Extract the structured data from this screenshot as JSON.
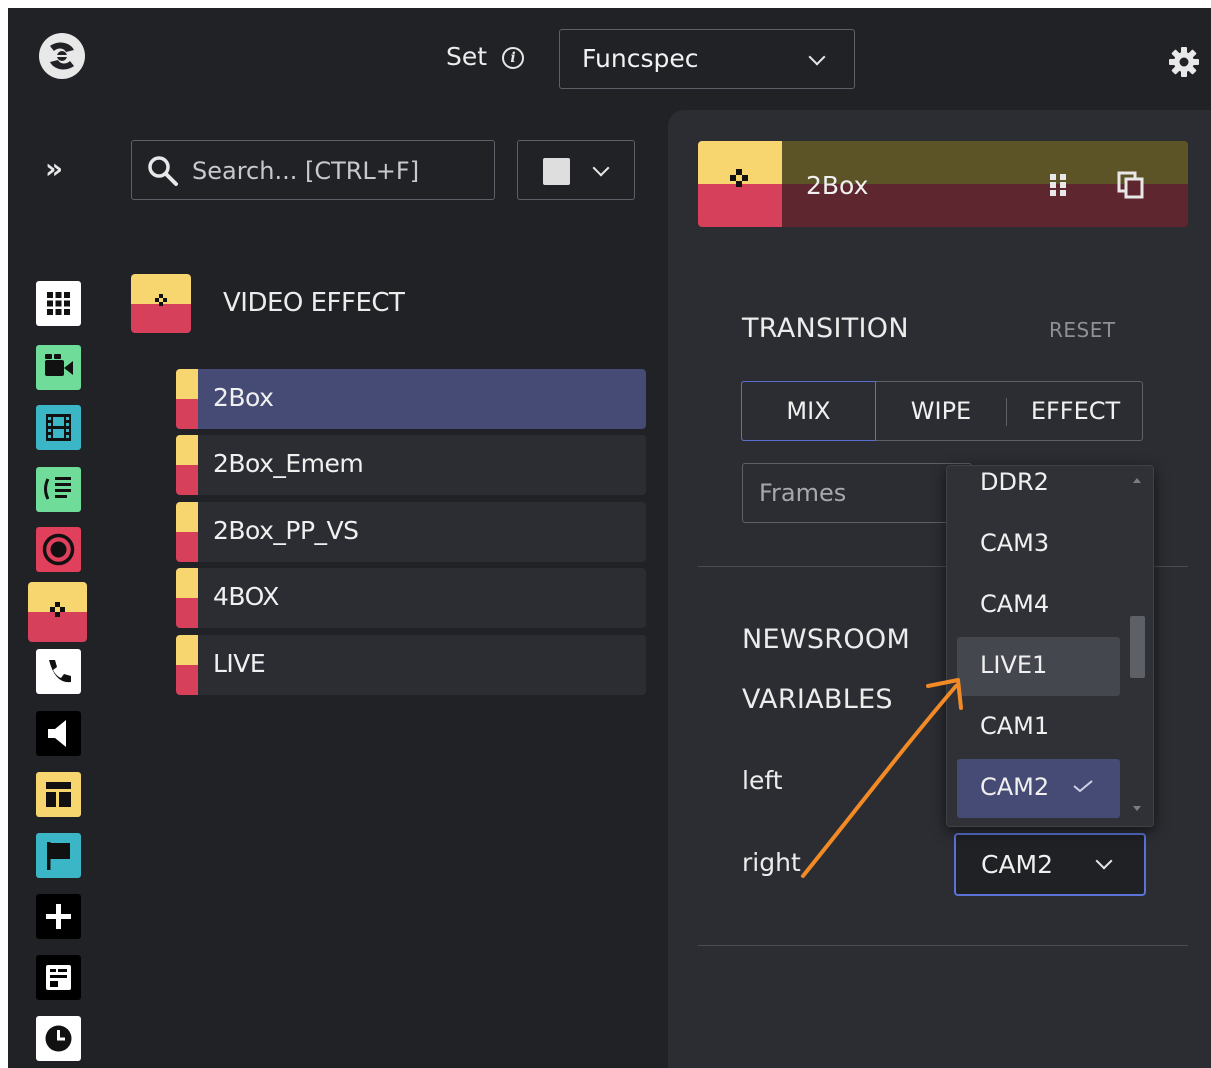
{
  "topbar": {
    "set_label": "Set",
    "set_info_icon": "info-icon",
    "set_value": "Funcspec",
    "settings_icon": "gear-icon"
  },
  "sidebar": {
    "expand_label": "»",
    "search_placeholder": "Search... [CTRL+F]",
    "items": [
      {
        "name": "grid-icon",
        "bg": "#ffffff"
      },
      {
        "name": "camera-icon",
        "bg": "#6fdc9a"
      },
      {
        "name": "film-icon",
        "bg": "#3bb6c6"
      },
      {
        "name": "voiceover-icon",
        "bg": "#6fdc9a"
      },
      {
        "name": "record-icon",
        "bg": "#e0405c"
      },
      {
        "name": "video-effect-icon",
        "bg": "#f7d56f",
        "active": true
      },
      {
        "name": "phone-icon",
        "bg": "#ffffff"
      },
      {
        "name": "speaker-icon",
        "bg": "#000000"
      },
      {
        "name": "layout-icon",
        "bg": "#f7d56f"
      },
      {
        "name": "flag-icon",
        "bg": "#3bb6c6"
      },
      {
        "name": "plus-icon",
        "bg": "#000000"
      },
      {
        "name": "playlist-icon",
        "bg": "#000000"
      },
      {
        "name": "clock-icon",
        "bg": "#ffffff"
      }
    ]
  },
  "category": {
    "label": "VIDEO EFFECT"
  },
  "effects": [
    {
      "label": "2Box",
      "selected": true
    },
    {
      "label": "2Box_Emem"
    },
    {
      "label": "2Box_PP_VS"
    },
    {
      "label": "4BOX"
    },
    {
      "label": "LIVE"
    }
  ],
  "detail": {
    "title": "2Box",
    "transition_title": "TRANSITION",
    "reset_label": "RESET",
    "transition_options": [
      "MIX",
      "WIPE",
      "EFFECT"
    ],
    "transition_active": "MIX",
    "frames_placeholder": "Frames",
    "newsroom_title_line1": "NEWSROOM",
    "newsroom_title_line2": "VARIABLES",
    "left_label": "left",
    "right_label": "right",
    "right_value": "CAM2"
  },
  "dropdown": {
    "options": [
      "DDR2",
      "CAM3",
      "CAM4",
      "LIVE1",
      "CAM1",
      "CAM2"
    ],
    "hovered": "LIVE1",
    "selected": "CAM2"
  },
  "colors": {
    "accent": "#5b73d6",
    "selected_bg": "#454b74",
    "yellow": "#f7d56f",
    "red": "#d6405a",
    "annotation": "#f28a26"
  }
}
